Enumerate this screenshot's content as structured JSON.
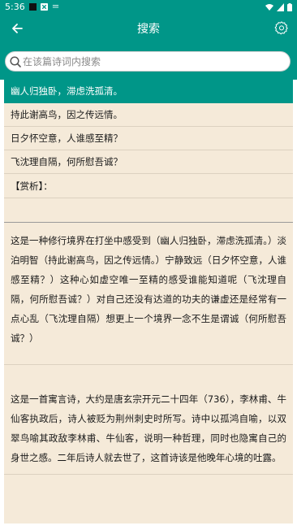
{
  "status_bar": {
    "time": "5:36"
  },
  "app_bar": {
    "title": "搜索"
  },
  "search": {
    "placeholder": "在该篇诗词内搜索"
  },
  "lines": [
    {
      "text": "幽人归独卧，滞虑洗孤清。",
      "selected": true
    },
    {
      "text": "持此谢高鸟，因之传远情。",
      "selected": false
    },
    {
      "text": "日夕怀空意，人谁感至精？",
      "selected": false
    },
    {
      "text": "飞沈理自隔，何所慰吾诚？",
      "selected": false
    }
  ],
  "section_label": "【赏析】：",
  "paragraphs": [
    "这是一种修行境界在打坐中感受到（幽人归独卧，滞虑洗孤清。）淡泊明智（持此谢高鸟，因之传远情。）宁静致远（日夕怀空意，人谁感至精？）这种心如虚空唯一至精的感受谁能知道呢（飞沈理自隔，何所慰吾诚？）对自己还没有达道的功夫的谦虚还是经常有一点心乱（飞沈理自隔）想更上一个境界一念不生是谓诚（何所慰吾诚？）",
    "这是一首寓言诗，大约是唐玄宗开元二十四年（736），李林甫、牛仙客执政后，诗人被贬为荆州刺史时所写。诗中以孤鸿自喻，以双翠鸟喻其政敌李林甫、牛仙客，说明一种哲理，同时也隐寓自己的身世之感。二年后诗人就去世了，这首诗该是他晚年心境的吐露。"
  ]
}
